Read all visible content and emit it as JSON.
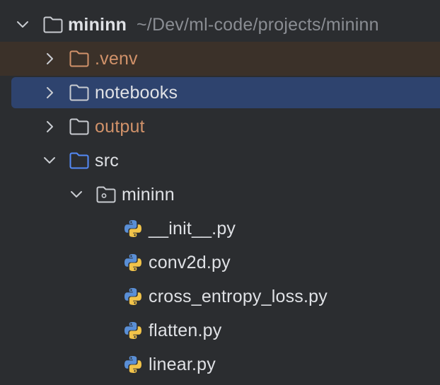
{
  "root": {
    "name": "mininn",
    "path": "~/Dev/ml-code/projects/mininn"
  },
  "items": [
    {
      "label": ".venv",
      "kind": "folder",
      "state": "collapsed",
      "highlight": "excluded",
      "color": "#d1926a"
    },
    {
      "label": "notebooks",
      "kind": "folder",
      "state": "collapsed",
      "selected": true
    },
    {
      "label": "output",
      "kind": "folder",
      "state": "collapsed",
      "color": "#d1926a"
    },
    {
      "label": "src",
      "kind": "source-folder",
      "state": "expanded",
      "icon_color": "#548af7"
    },
    {
      "label": "mininn",
      "kind": "package",
      "state": "expanded"
    },
    {
      "label": "__init__.py",
      "kind": "python-file"
    },
    {
      "label": "conv2d.py",
      "kind": "python-file"
    },
    {
      "label": "cross_entropy_loss.py",
      "kind": "python-file"
    },
    {
      "label": "flatten.py",
      "kind": "python-file"
    },
    {
      "label": "linear.py",
      "kind": "python-file"
    }
  ],
  "colors": {
    "background": "#2b2d30",
    "selection": "#2e436e",
    "excluded_background": "#3b3129",
    "excluded_text": "#d1926a",
    "text": "#dfe1e5",
    "path_text": "#8a8d93",
    "source_folder_icon": "#548af7",
    "python_blue": "#5a8fd6",
    "python_yellow": "#f1c34a"
  }
}
